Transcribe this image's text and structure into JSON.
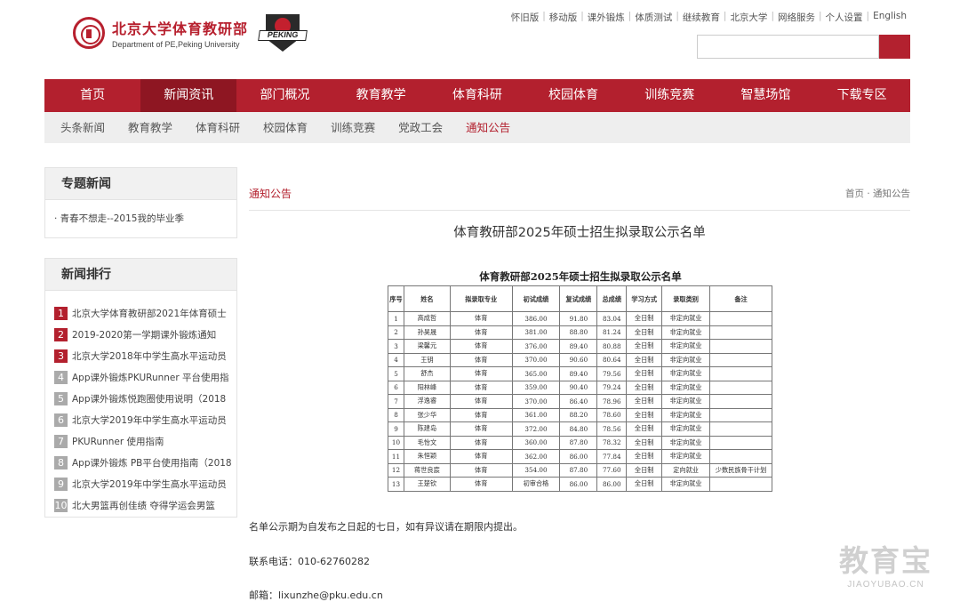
{
  "header": {
    "logo_cn": "北京大学体育教研部",
    "logo_en": "Department of PE,Peking University",
    "badge_text": "PEKING",
    "toplinks": [
      "怀旧版",
      "移动版",
      "课外锻炼",
      "体质测试",
      "继续教育",
      "北京大学",
      "网络服务",
      "个人设置",
      "English"
    ],
    "search_placeholder": "",
    "colors": {
      "brand": "#b3202e",
      "brand_dark": "#8e1622"
    }
  },
  "nav": {
    "main": [
      "首页",
      "新闻资讯",
      "部门概况",
      "教育教学",
      "体育科研",
      "校园体育",
      "训练竞赛",
      "智慧场馆",
      "下载专区"
    ],
    "main_active": 1,
    "sub": [
      "头条新闻",
      "教育教学",
      "体育科研",
      "校园体育",
      "训练竞赛",
      "党政工会",
      "通知公告"
    ],
    "sub_active": 6
  },
  "sidebar": {
    "special_title": "专题新闻",
    "special_items": [
      "· 青春不想走--2015我的毕业季"
    ],
    "ranking_title": "新闻排行",
    "ranking": [
      {
        "num": "1",
        "text": "北京大学体育教研部2021年体育硕士"
      },
      {
        "num": "2",
        "text": "2019-2020第一学期课外锻炼通知"
      },
      {
        "num": "3",
        "text": "北京大学2018年中学生高水平运动员"
      },
      {
        "num": "4",
        "text": "App课外锻炼PKURunner 平台使用指"
      },
      {
        "num": "5",
        "text": "App课外锻炼悦跑圈使用说明（2018"
      },
      {
        "num": "6",
        "text": "北京大学2019年中学生高水平运动员"
      },
      {
        "num": "7",
        "text": "PKURunner 使用指南"
      },
      {
        "num": "8",
        "text": "App课外锻炼 PB平台使用指南（2018"
      },
      {
        "num": "9",
        "text": "北京大学2019年中学生高水平运动员"
      },
      {
        "num": "10",
        "text": "北大男篮再创佳绩 夺得学运会男篮"
      }
    ]
  },
  "content": {
    "section_title": "通知公告",
    "breadcrumb": "首页 · 通知公告",
    "article_title": "体育教研部2025年硕士招生拟录取公示名单",
    "doc_title": "体育教研部2025年硕士招生拟录取公示名单",
    "table_headers": [
      "序号",
      "姓名",
      "拟录取专业",
      "初试成绩",
      "复试成绩",
      "总成绩",
      "学习方式",
      "录取类别",
      "备注"
    ],
    "table_rows": [
      [
        "1",
        "高成哲",
        "体育",
        "386.00",
        "91.80",
        "83.04",
        "全日制",
        "非定向就业",
        ""
      ],
      [
        "2",
        "孙昊晟",
        "体育",
        "381.00",
        "88.80",
        "81.24",
        "全日制",
        "非定向就业",
        ""
      ],
      [
        "3",
        "梁馨元",
        "体育",
        "376.00",
        "89.40",
        "80.88",
        "全日制",
        "非定向就业",
        ""
      ],
      [
        "4",
        "王钥",
        "体育",
        "370.00",
        "90.60",
        "80.64",
        "全日制",
        "非定向就业",
        ""
      ],
      [
        "5",
        "舒杰",
        "体育",
        "365.00",
        "89.40",
        "79.56",
        "全日制",
        "非定向就业",
        ""
      ],
      [
        "6",
        "阳林峰",
        "体育",
        "359.00",
        "90.40",
        "79.24",
        "全日制",
        "非定向就业",
        ""
      ],
      [
        "7",
        "浮逸睿",
        "体育",
        "370.00",
        "86.40",
        "78.96",
        "全日制",
        "非定向就业",
        ""
      ],
      [
        "8",
        "张少华",
        "体育",
        "361.00",
        "88.20",
        "78.60",
        "全日制",
        "非定向就业",
        ""
      ],
      [
        "9",
        "陈建岛",
        "体育",
        "372.00",
        "84.80",
        "78.56",
        "全日制",
        "非定向就业",
        ""
      ],
      [
        "10",
        "毛怡文",
        "体育",
        "360.00",
        "87.80",
        "78.32",
        "全日制",
        "非定向就业",
        ""
      ],
      [
        "11",
        "朱恒颖",
        "体育",
        "362.00",
        "86.00",
        "77.84",
        "全日制",
        "非定向就业",
        ""
      ],
      [
        "12",
        "蒋世良宸",
        "体育",
        "354.00",
        "87.80",
        "77.60",
        "全日制",
        "定向就业",
        "少数民族骨干计划"
      ],
      [
        "13",
        "王楚钦",
        "体育",
        "初审合格",
        "86.00",
        "86.00",
        "全日制",
        "非定向就业",
        ""
      ]
    ],
    "notice_text": "名单公示期为自发布之日起的七日，如有异议请在期限内提出。",
    "phone_text": "联系电话：010-62760282",
    "email_text": "邮箱：lixunzhe@pku.edu.cn"
  },
  "watermark": {
    "cn": "教育宝",
    "en": "JIAOYUBAO.CN"
  }
}
